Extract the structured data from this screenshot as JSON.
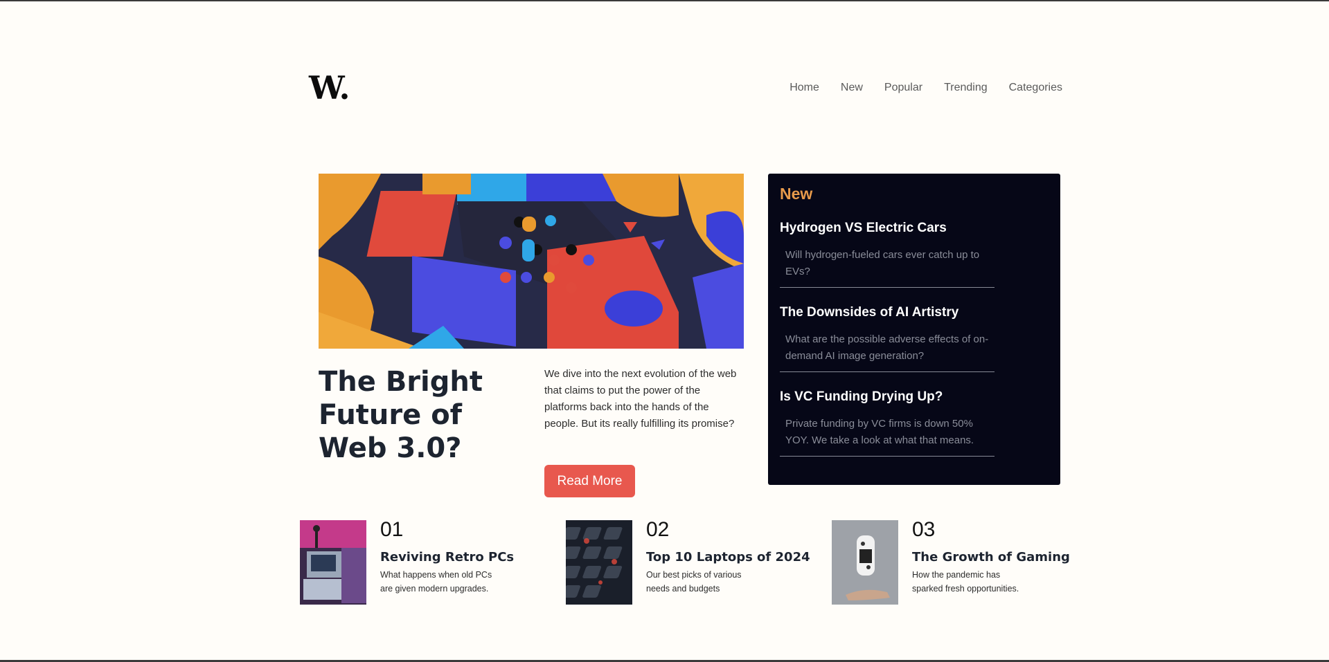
{
  "header": {
    "logo": "W.",
    "nav": [
      "Home",
      "New",
      "Popular",
      "Trending",
      "Categories"
    ]
  },
  "hero": {
    "title": "The Bright Future of Web 3.0?",
    "description": "We dive into the next evolution of the web that claims to put the power of the platforms back into the hands of the people. But its really fulfilling its promise?",
    "button_label": "Read More"
  },
  "new_panel": {
    "heading": "New",
    "items": [
      {
        "title": "Hydrogen VS Electric Cars",
        "desc": "Will hydrogen-fueled cars ever catch up to EVs?"
      },
      {
        "title": "The Downsides of AI Artistry",
        "desc": "What are the possible adverse effects of on-demand AI image generation?"
      },
      {
        "title": "Is VC Funding Drying Up?",
        "desc": "Private funding by VC firms is down 50% YOY. We take a look at what that means."
      }
    ]
  },
  "articles": [
    {
      "num": "01",
      "title": "Reviving Retro PCs",
      "desc": "What happens when old PCs are given modern upgrades."
    },
    {
      "num": "02",
      "title": "Top 10 Laptops of 2024",
      "desc": "Our best picks of various needs and budgets"
    },
    {
      "num": "03",
      "title": "The Growth of Gaming",
      "desc": "How the pandemic has sparked fresh opportunities."
    }
  ],
  "colors": {
    "accent": "#e8584e",
    "panel_bg": "#060717",
    "panel_heading": "#e79a4b",
    "background": "#fffdf9"
  }
}
